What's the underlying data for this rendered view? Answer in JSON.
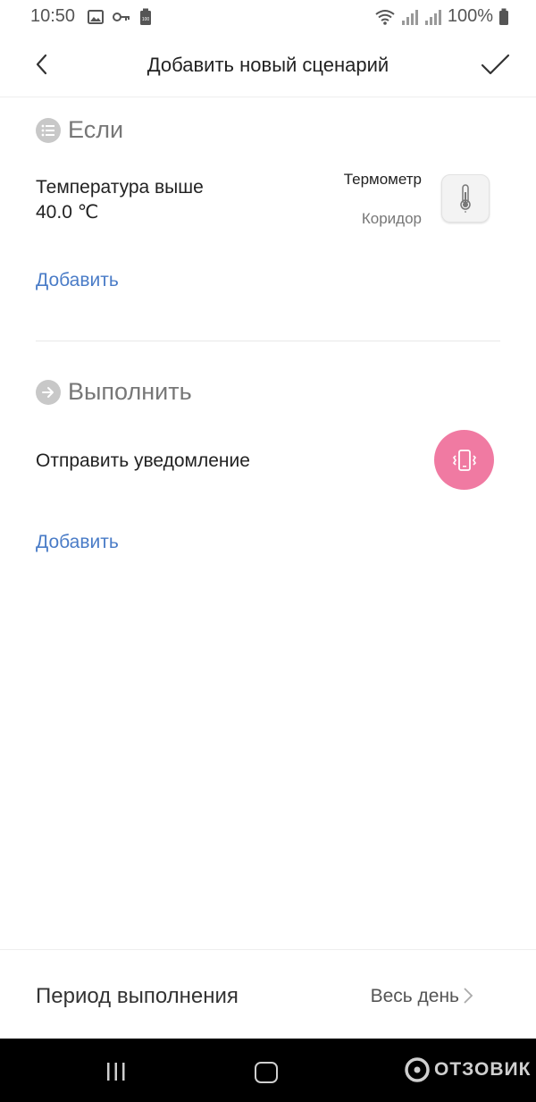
{
  "status_bar": {
    "time": "10:50",
    "battery_percent": "100%",
    "battery_badge": "100"
  },
  "header": {
    "title": "Добавить новый сценарий"
  },
  "if_section": {
    "title": "Если",
    "condition": {
      "line1": "Температура выше",
      "line2": "40.0 ℃",
      "device_name": "Термометр",
      "device_room": "Коридор"
    },
    "add_label": "Добавить"
  },
  "do_section": {
    "title": "Выполнить",
    "action": "Отправить уведомление",
    "add_label": "Добавить"
  },
  "period": {
    "label": "Период выполнения",
    "value": "Весь день"
  },
  "watermark": {
    "text": "ОТЗОВИК"
  },
  "colors": {
    "link": "#4a7cc7",
    "notify_button": "#f07aa2",
    "section_icon": "#c8c8c8"
  }
}
